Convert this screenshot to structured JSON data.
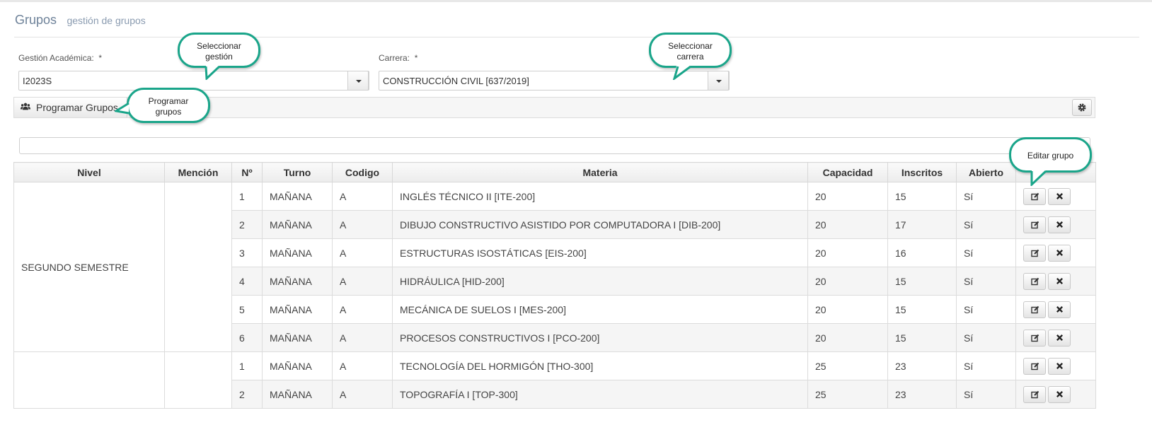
{
  "header": {
    "title": "Grupos",
    "subtitle": "gestión de grupos"
  },
  "form": {
    "gestion": {
      "label": "Gestión Académica:",
      "required": "*",
      "value": "I2023S"
    },
    "carrera": {
      "label": "Carrera:",
      "required": "*",
      "value": "CONSTRUCCIÓN CIVIL [637/2019]"
    }
  },
  "toolbar": {
    "program_label": "Programar Grupos",
    "program_icon": "users-icon",
    "settings_icon": "gear-icon"
  },
  "table": {
    "columns": [
      "Nivel",
      "Mención",
      "Nº",
      "Turno",
      "Codigo",
      "Materia",
      "Capacidad",
      "Inscritos",
      "Abierto"
    ],
    "groups": [
      {
        "nivel": "SEGUNDO SEMESTRE",
        "mencion": "",
        "rows": [
          [
            "1",
            "MAÑANA",
            "A",
            "INGLÉS TÉCNICO II [ITE-200]",
            "20",
            "15",
            "Sí"
          ],
          [
            "2",
            "MAÑANA",
            "A",
            "DIBUJO CONSTRUCTIVO ASISTIDO POR COMPUTADORA I [DIB-200]",
            "20",
            "17",
            "Sí"
          ],
          [
            "3",
            "MAÑANA",
            "A",
            "ESTRUCTURAS ISOSTÁTICAS [EIS-200]",
            "20",
            "16",
            "Sí"
          ],
          [
            "4",
            "MAÑANA",
            "A",
            "HIDRÁULICA [HID-200]",
            "20",
            "15",
            "Sí"
          ],
          [
            "5",
            "MAÑANA",
            "A",
            "MECÁNICA DE SUELOS I [MES-200]",
            "20",
            "15",
            "Sí"
          ],
          [
            "6",
            "MAÑANA",
            "A",
            "PROCESOS CONSTRUCTIVOS I [PCO-200]",
            "20",
            "15",
            "Sí"
          ]
        ]
      },
      {
        "nivel": "",
        "mencion": "",
        "rows": [
          [
            "1",
            "MAÑANA",
            "A",
            "TECNOLOGÍA DEL HORMIGÓN [THO-300]",
            "25",
            "23",
            "Sí"
          ],
          [
            "2",
            "MAÑANA",
            "A",
            "TOPOGRAFÍA I [TOP-300]",
            "25",
            "23",
            "Sí"
          ]
        ]
      }
    ],
    "row_actions": {
      "edit_icon": "edit-icon",
      "delete_icon": "close-icon"
    }
  },
  "callouts": {
    "gestion": [
      "Seleccionar",
      "gestión"
    ],
    "carrera": [
      "Seleccionar",
      "carrera"
    ],
    "programar": [
      "Programar",
      "grupos"
    ],
    "editar": [
      "Editar grupo"
    ]
  },
  "colors": {
    "accent": "#1aa58a",
    "title": "#6e8299"
  }
}
